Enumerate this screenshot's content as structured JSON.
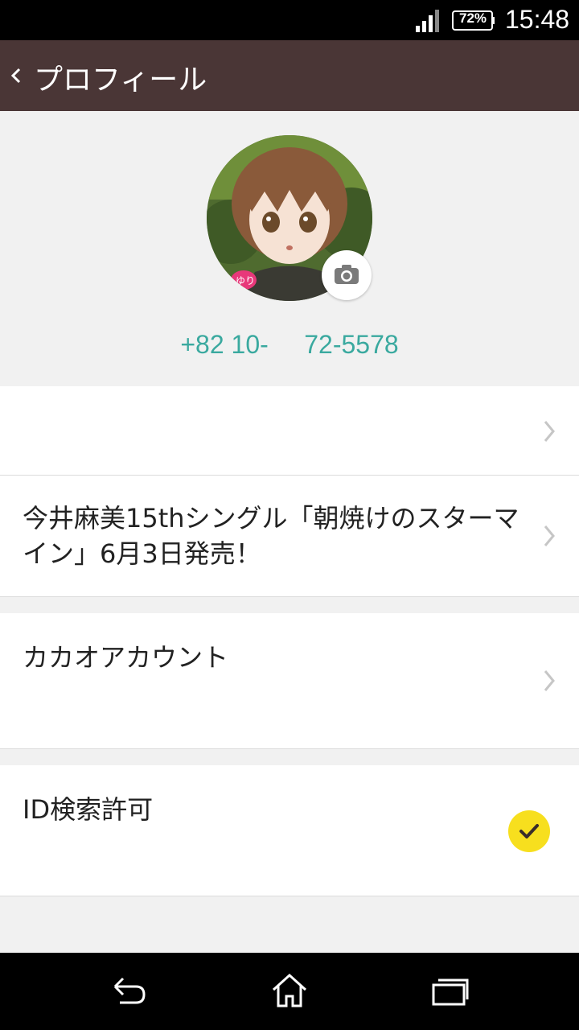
{
  "status_bar": {
    "battery": "72%",
    "time": "15:48"
  },
  "app_bar": {
    "title": "プロフィール"
  },
  "profile": {
    "phone": "+82 10-     72-5578"
  },
  "rows": {
    "name": "",
    "status_message": "今井麻美15thシングル「朝焼けのスターマイン」6月3日発売！",
    "kakao_account": "カカオアカウント",
    "id_search": "ID検索許可"
  },
  "colors": {
    "app_bar_bg": "#4a3636",
    "accent_teal": "#3aa99f",
    "check_yellow": "#f7df1e"
  }
}
